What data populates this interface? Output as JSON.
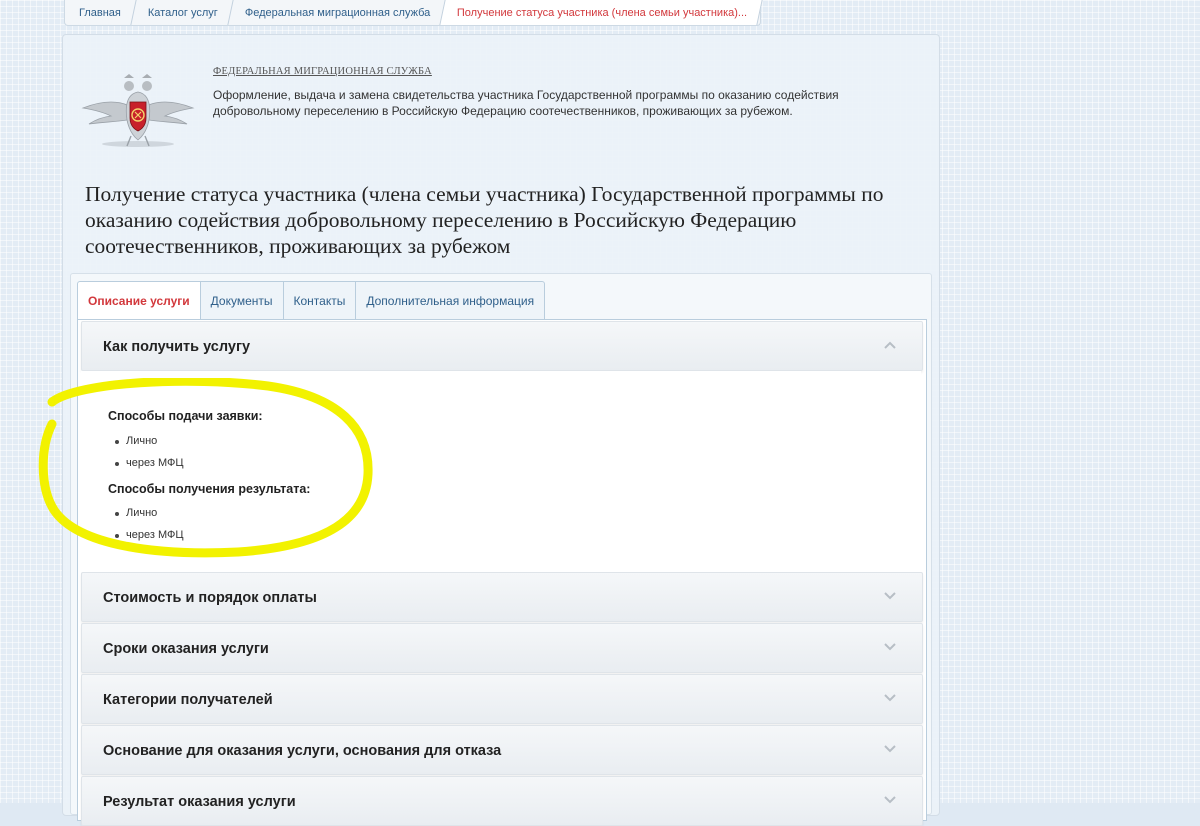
{
  "breadcrumb": {
    "items": [
      {
        "label": "Главная"
      },
      {
        "label": "Каталог услуг"
      },
      {
        "label": "Федеральная миграционная служба"
      },
      {
        "label": "Получение статуса участника (члена семьи участника)..."
      }
    ]
  },
  "org": {
    "name": "ФЕДЕРАЛЬНАЯ МИГРАЦИОННАЯ СЛУЖБА",
    "description": "Оформление, выдача и замена свидетельства участника Государственной программы по оказанию содействия добровольному переселению в Российскую Федерацию соотечественников, проживающих за рубежом.",
    "emblem_icon": "fms-eagle-emblem-icon"
  },
  "page_title": "Получение статуса участника (члена семьи участника) Государственной программы по оказанию содействия добровольному переселению в Российскую Федерацию соотечественников, проживающих за рубежом",
  "tabs": [
    {
      "label": "Описание услуги",
      "active": true
    },
    {
      "label": "Документы"
    },
    {
      "label": "Контакты"
    },
    {
      "label": "Дополнительная информация"
    }
  ],
  "accordion": {
    "open_section": {
      "title": "Как получить услугу",
      "submit_heading": "Способы подачи заявки:",
      "submit_methods": [
        "Лично",
        "через МФЦ"
      ],
      "result_heading": "Способы получения результата:",
      "result_methods": [
        "Лично",
        "через МФЦ"
      ]
    },
    "sections": [
      {
        "title": "Стоимость и порядок оплаты"
      },
      {
        "title": "Сроки оказания услуги"
      },
      {
        "title": "Категории получателей"
      },
      {
        "title": "Основание для оказания услуги, основания для отказа"
      },
      {
        "title": "Результат оказания услуги"
      }
    ]
  },
  "colors": {
    "active_red": "#d2383c",
    "link_blue": "#2f5f8a",
    "highlight_yellow": "#f2f200"
  }
}
